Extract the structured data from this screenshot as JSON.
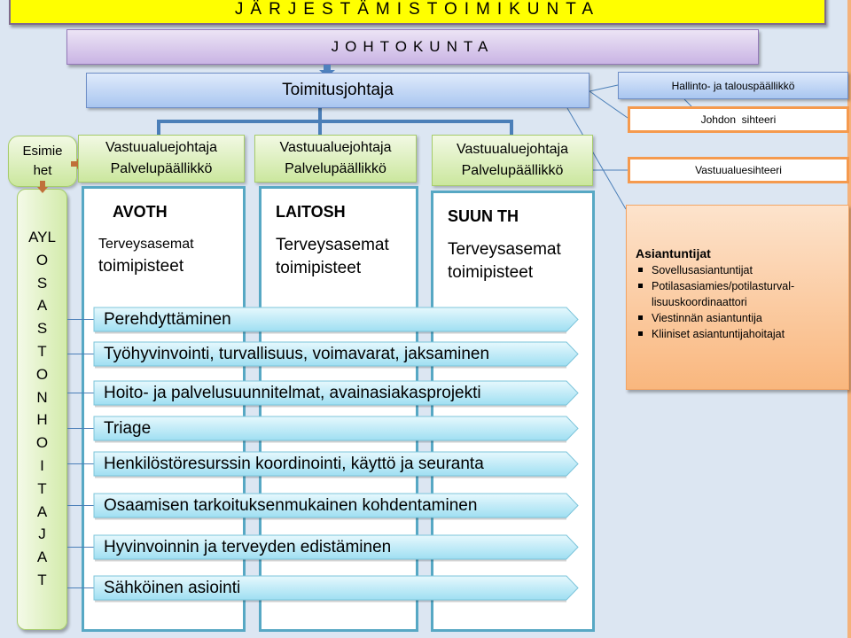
{
  "header": {
    "organizing_committee": "JÄRJESTÄMISTOIMIKUNTA",
    "board": "JOHTOKUNTA",
    "ceo": "Toimitusjohtaja"
  },
  "staff": {
    "admin_finance_manager": "Hallinto- ja talouspäällikkö",
    "management_secretary": "Johdon  sihteeri",
    "area_secretary": "Vastuualuesihteeri"
  },
  "experts": {
    "title": "Asiantuntijat",
    "items": [
      "Sovellusasiantuntijat",
      "Potilasasiamies/potilasturval-lisuuskoordinaattori",
      "Viestinnän asiantuntija",
      "Kliiniset asiantuntijahoitajat"
    ]
  },
  "supervisors": {
    "line1": "Esimie",
    "line2": "het"
  },
  "head_nurses_letters": [
    "AYL",
    "O",
    "S",
    "A",
    "S",
    "T",
    "O",
    "N",
    "H",
    "O",
    "I",
    "T",
    "A",
    "J",
    "A",
    "T"
  ],
  "area_heads": [
    {
      "line1": "Vastuualuejohtaja",
      "line2": "Palvelupäällikkö"
    },
    {
      "line1": "Vastuualuejohtaja",
      "line2": "Palvelupäällikkö"
    },
    {
      "line1": "Vastuualuejohtaja",
      "line2": "Palvelupäällikkö"
    }
  ],
  "units": [
    {
      "name": "AVOTH",
      "line1": "Terveysasemat",
      "line2": "toimipisteet"
    },
    {
      "name": "LAITOSH",
      "line1": "Terveysasemat",
      "line2": "toimipisteet"
    },
    {
      "name": "SUUN TH",
      "line1": "Terveysasemat",
      "line2": "toimipisteet"
    }
  ],
  "tasks": [
    "Perehdyttäminen",
    "Työhyvinvointi, turvallisuus, voimavarat, jaksaminen",
    "Hoito- ja palvelusuunnitelmat, avainasiakasprojekti",
    "Triage",
    "Henkilöstöresurssin koordinointi, käyttö ja seuranta",
    "Osaamisen tarkoituksenmukainen kohdentaminen",
    "Hyvinvoinnin ja terveyden edistäminen",
    "Sähköinen asiointi"
  ],
  "colors": {
    "background": "#dce6f2",
    "organizing_committee": "#ffff00",
    "board": "#c9b4e4",
    "ceo": "#a9c6f0",
    "area_head": "#cbe79e",
    "secretary_border": "#f59a4e",
    "experts": "#f9b77e",
    "unit_border": "#57a8c4",
    "task": "#aee6f5",
    "connector": "#4b7fb8"
  }
}
